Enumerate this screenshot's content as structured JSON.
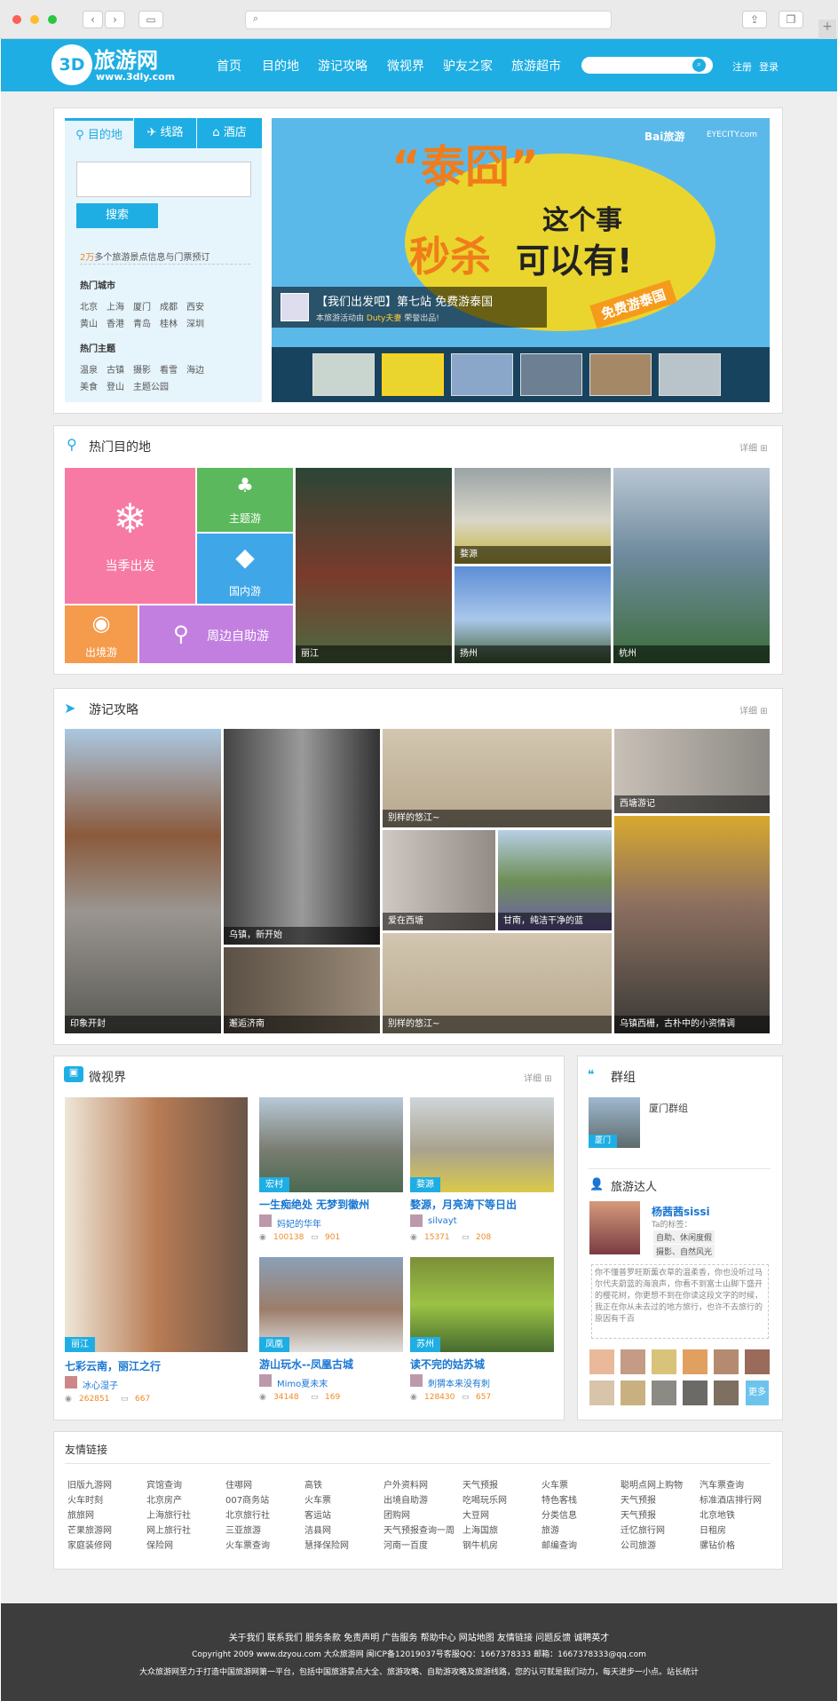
{
  "browser": {
    "new_tab": "+"
  },
  "header": {
    "logo_mark": "3D",
    "logo_name": "旅游网",
    "logo_url": "www.3dly.com",
    "nav": [
      "首页",
      "目的地",
      "游记攻略",
      "微视界",
      "驴友之家",
      "旅游超市"
    ],
    "register": "注册",
    "login": "登录"
  },
  "search_panel": {
    "tabs": [
      "目的地",
      "线路",
      "酒店"
    ],
    "search_button": "搜索",
    "info_count": "2万",
    "info_rest": "多个旅游景点信息与门票预订",
    "hot_cities_title": "热门城市",
    "hot_cities": [
      [
        "北京",
        "上海",
        "厦门",
        "成都",
        "西安"
      ],
      [
        "黄山",
        "香港",
        "青岛",
        "桂林",
        "深圳"
      ]
    ],
    "hot_topics_title": "热门主题",
    "hot_topics": [
      [
        "温泉",
        "古镇",
        "摄影",
        "看雪",
        "海边"
      ],
      [
        "美食",
        "登山",
        "主题公园"
      ]
    ]
  },
  "banner": {
    "brand1": "Bai",
    "brand1b": "旅游",
    "brand2": "EYECITY.com",
    "headline1": "“泰囧”",
    "headline2": "这个事",
    "headline3": "秒杀",
    "headline4": "可以有!",
    "ribbon": "免费游泰国",
    "caption": "【我们出发吧】第七站 免费游泰国",
    "subcaption": "本旅游活动由",
    "sponsor": "Duty夫妻",
    "subcaption2": "荣誉出品!"
  },
  "hot_destinations": {
    "title": "热门目的地",
    "more": "详细",
    "seasonal": "当季出发",
    "theme": "主题游",
    "domestic": "国内游",
    "outbound": "出境游",
    "nearby": "周边自助游",
    "places": [
      "丽江",
      "婺源",
      "扬州",
      "杭州"
    ]
  },
  "travel_notes": {
    "title": "游记攻略",
    "more": "详细",
    "items": [
      "印象开封",
      "乌镇，新开始",
      "别样的悠江~",
      "西塘游记",
      "爱在西塘",
      "甘南，纯洁干净的蓝",
      "邂逅济南",
      "别样的悠江~",
      "乌镇西栅，古朴中的小资情调"
    ]
  },
  "micro_view": {
    "title": "微视界",
    "more": "详细",
    "featured": {
      "tag": "丽江",
      "title": "七彩云南，丽江之行",
      "user": "冰心湿子",
      "views": "262851",
      "comments": "667"
    },
    "items": [
      {
        "tag": "宏村",
        "title": "一生痴绝处 无梦到徽州",
        "user": "妈妃的华年",
        "views": "100138",
        "comments": "901"
      },
      {
        "tag": "婺源",
        "title": "婺源，月亮涛下等日出",
        "user": "silvayt",
        "views": "15371",
        "comments": "208"
      },
      {
        "tag": "凤凰",
        "title": "游山玩水--凤凰古城",
        "user": "Mimo夏未末",
        "views": "34148",
        "comments": "169"
      },
      {
        "tag": "苏州",
        "title": "读不完的姑苏城",
        "user": "刺猬本来没有刺",
        "views": "128430",
        "comments": "657"
      }
    ]
  },
  "group": {
    "title": "群组",
    "name": "厦门群组",
    "badge": "厦门"
  },
  "expert": {
    "title": "旅游达人",
    "name": "杨茜茜sissi",
    "tag_label": "Ta的标签：",
    "tags": [
      "自助、休闲度假",
      "摄影、自然风光"
    ],
    "bio": "你不懂普罗旺斯薰衣草的温柔香，你也没听过马尔代夫蔚蓝的海浪声，你看不到富士山脚下盛开的樱花树，你更想不到在你读这段文字的时候，我正在你从未去过的地方旅行，也许不去旅行的原因有千百",
    "more": "更多"
  },
  "friend_links": {
    "title": "友情链接",
    "cols": [
      [
        "旧版九游网",
        "火车时刻",
        "旅旅网",
        "芒果旅游网",
        "家庭装修网"
      ],
      [
        "宾馆查询",
        "北京房产",
        "上海旅行社",
        "网上旅行社",
        "保险网"
      ],
      [
        "住哪网",
        "007商务站",
        "北京旅行社",
        "三亚旅游",
        "火车票查询"
      ],
      [
        "高铁",
        "火车票",
        "客运站",
        "洁县网",
        "慧择保险网"
      ],
      [
        "户外资料网",
        "出境自助游",
        "团购网",
        "天气预报查询一周",
        "河南一百度"
      ],
      [
        "天气预报",
        "吃喝玩乐网",
        "大豆网",
        "上海国旅",
        "钢牛机房"
      ],
      [
        "火车票",
        "特色客栈",
        "分类信息",
        "旅游",
        "邮编查询"
      ],
      [
        "聪明点网上购物",
        "天气预报",
        "天气预报",
        "迁忆旅行网",
        "公司旅游"
      ],
      [
        "汽车票查询",
        "标准酒店排行网",
        "北京地铁",
        "日租房",
        "骡钻价格"
      ]
    ]
  },
  "footer": {
    "links": "关于我们  联系我们  服务条款  免责声明  广告服务  帮助中心  网站地图  友情链接  问题反馈  诚聘英才",
    "copyright": "Copyright 2009 www.dzyou.com 大众旅游网 闽ICP备12019037号客服QQ：1667378333   邮箱：1667378333@qq.com",
    "slogan": "大众旅游网至力于打造中国旅游网第一平台，包括中国旅游景点大全、旅游攻略、自助游攻略及旅游线路，您的认可就是我们动力，每天进步一小点。站长统计"
  },
  "colors": {
    "brand": "#1eaee3",
    "pink": "#f77aa4",
    "green": "#5cb85c",
    "orange": "#f59b4c",
    "purple": "#c27fe0"
  }
}
